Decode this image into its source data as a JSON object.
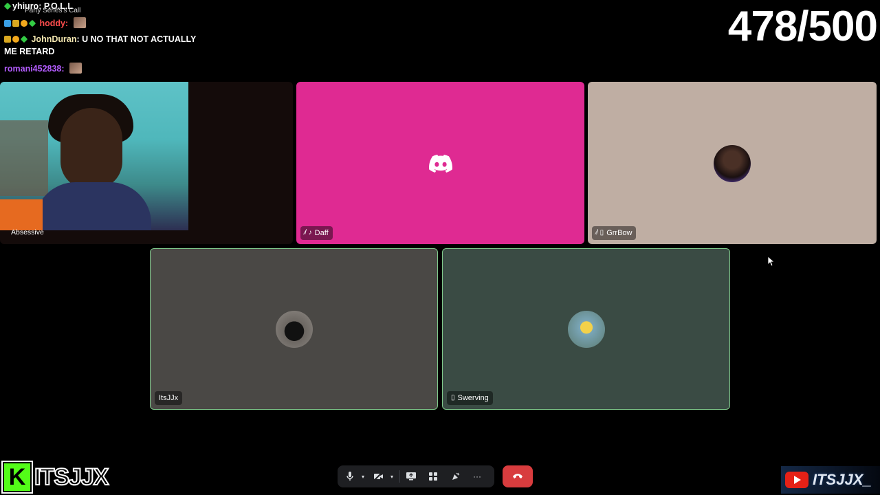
{
  "chat": {
    "caption": "Party Series's Call",
    "lines": [
      {
        "user": "yhiuro",
        "user_color": "#ffffff",
        "message": "P.O.L.L"
      },
      {
        "user": "hoddy",
        "user_color": "#ff4d4d",
        "message": ""
      },
      {
        "user": "JohnDuran",
        "user_color": "#f4e7b0",
        "message": "U NO THAT NOT ACTUALLY",
        "message_cont": "ME RETARD"
      },
      {
        "user": "romani452838",
        "user_color": "#b45cff",
        "message": ""
      }
    ]
  },
  "counter": "478/500",
  "tiles": [
    {
      "name": "Absessive",
      "type": "webcam"
    },
    {
      "name": "Daff",
      "type": "discord-default",
      "color": "#df2a92"
    },
    {
      "name": "GrrBow",
      "type": "avatar",
      "color": "#bfaea3"
    },
    {
      "name": "ItsJJx",
      "type": "avatar",
      "speaking": true
    },
    {
      "name": "Swerving",
      "type": "avatar",
      "speaking": true
    }
  ],
  "controls": {
    "icons": [
      "microphone-icon",
      "chevron-down-icon",
      "camera-off-icon",
      "chevron-down-icon",
      "screen-share-icon",
      "activities-icon",
      "soundboard-icon",
      "more-icon",
      "hang-up-icon"
    ]
  },
  "branding": {
    "kick_letter": "K",
    "kick_name": "ITSJJX",
    "youtube_name": "ITSJJX_"
  }
}
